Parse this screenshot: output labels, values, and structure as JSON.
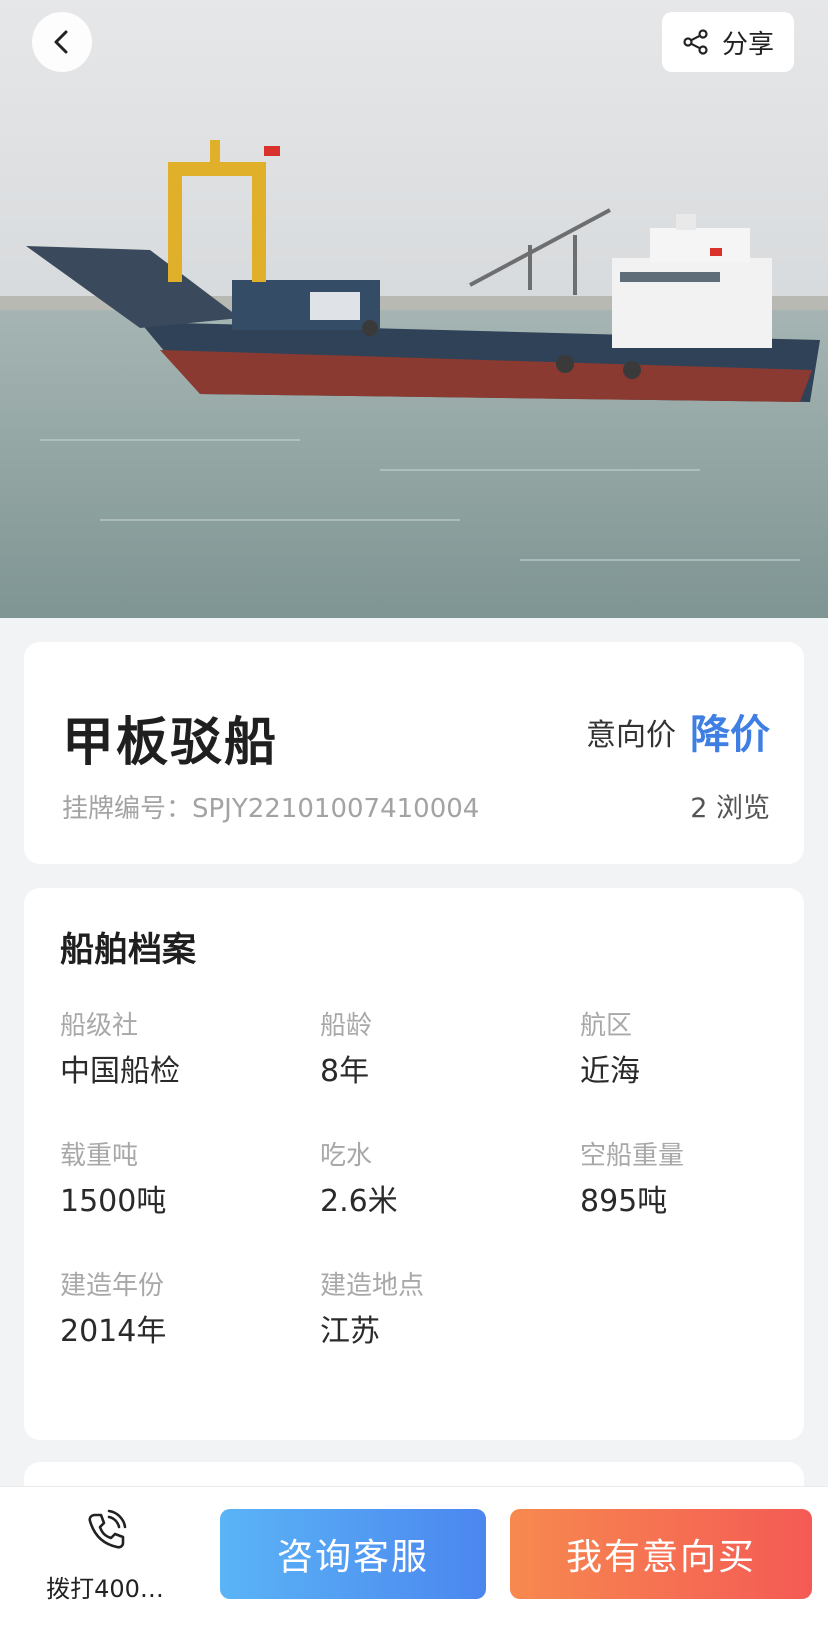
{
  "header": {
    "share_label": "分享"
  },
  "listing": {
    "title": "甲板驳船",
    "price_label": "意向价",
    "price_value": "降价",
    "listing_no": "挂牌编号：SPJY22101007410004",
    "views": "2 浏览"
  },
  "profile": {
    "title": "船舶档案",
    "fields": [
      {
        "label": "船级社",
        "value": "中国船检"
      },
      {
        "label": "船龄",
        "value": "8年"
      },
      {
        "label": "航区",
        "value": "近海"
      },
      {
        "label": "载重吨",
        "value": "1500吨"
      },
      {
        "label": "吃水",
        "value": "2.6米"
      },
      {
        "label": "空船重量",
        "value": "895吨"
      },
      {
        "label": "建造年份",
        "value": "2014年"
      },
      {
        "label": "建造地点",
        "value": "江苏"
      }
    ]
  },
  "bottom": {
    "call_label": "拨打400…",
    "consult_label": "咨询客服",
    "buy_label": "我有意向买"
  },
  "colors": {
    "accent_blue": "#3f7fe4",
    "consult_gradient": [
      "#5bb4f6",
      "#4b86ef"
    ],
    "buy_gradient": [
      "#f7894f",
      "#f45a55"
    ]
  },
  "icons": [
    "chevron-left-icon",
    "share-icon",
    "phone-icon"
  ]
}
